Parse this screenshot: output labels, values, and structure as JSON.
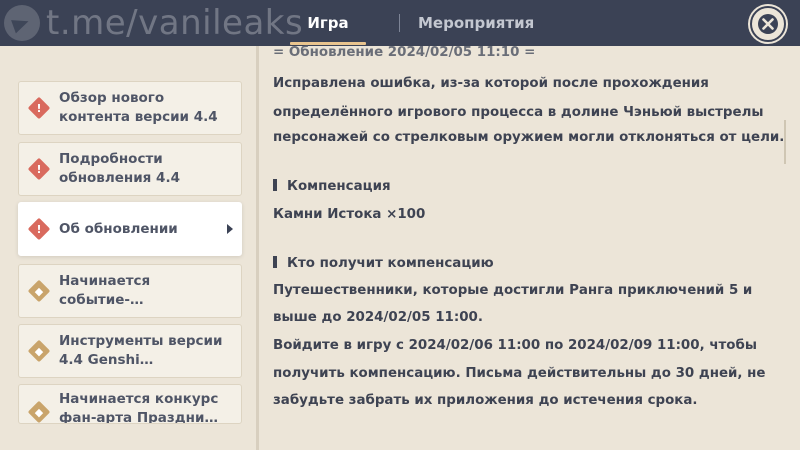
{
  "watermark": "t.me/vanileaks",
  "tabs": {
    "game": "Игра",
    "events": "Мероприятия"
  },
  "sidebar": {
    "items": [
      {
        "label": "Обзор нового контента версии 4.4",
        "type": "alert"
      },
      {
        "label": "Подробности обновления 4.4",
        "type": "alert"
      },
      {
        "label": "Об обновлении",
        "type": "alert",
        "selected": true
      },
      {
        "label": "Начинается событие-…",
        "type": "event"
      },
      {
        "label": "Инструменты версии 4.4 Genshi…",
        "type": "event"
      },
      {
        "label": "Начинается конкурс фан-арта Праздни…",
        "type": "event"
      }
    ]
  },
  "content": {
    "header_cut": "= Обновление 2024/02/05 11:10 =",
    "fix_line1": "Исправлена ошибка, из-за которой после прохождения",
    "fix_line2": "определённого игрового процесса в долине Чэньюй выстрелы",
    "fix_line3": "персонажей со стрелковым оружием могли отклоняться от цели.",
    "compensation_heading": "Компенсация",
    "compensation_value": "Камни Истока ×100",
    "recipients_heading": "Кто получит компенсацию",
    "recipients_line1": "Путешественники, которые достигли Ранга приключений 5 и",
    "recipients_line2": "выше до 2024/02/05 11:00.",
    "recipients_line3": "Войдите в игру с 2024/02/06 11:00 по 2024/02/09 11:00, чтобы",
    "recipients_line4": "получить компенсацию. Письма действительны до 30 дней, не",
    "recipients_line5": "забудьте забрать их приложения до истечения срока."
  },
  "colors": {
    "topbar": "#3b4255",
    "background": "#ece5d8",
    "accent_underline": "#e9c48e",
    "alert_badge": "#d96a5e",
    "event_badge": "#c9a46b"
  },
  "icons": {
    "close": "close-icon",
    "alert": "alert-diamond-icon",
    "event": "event-diamond-icon",
    "selected_arrow": "caret-right-icon",
    "telegram": "telegram-icon"
  }
}
